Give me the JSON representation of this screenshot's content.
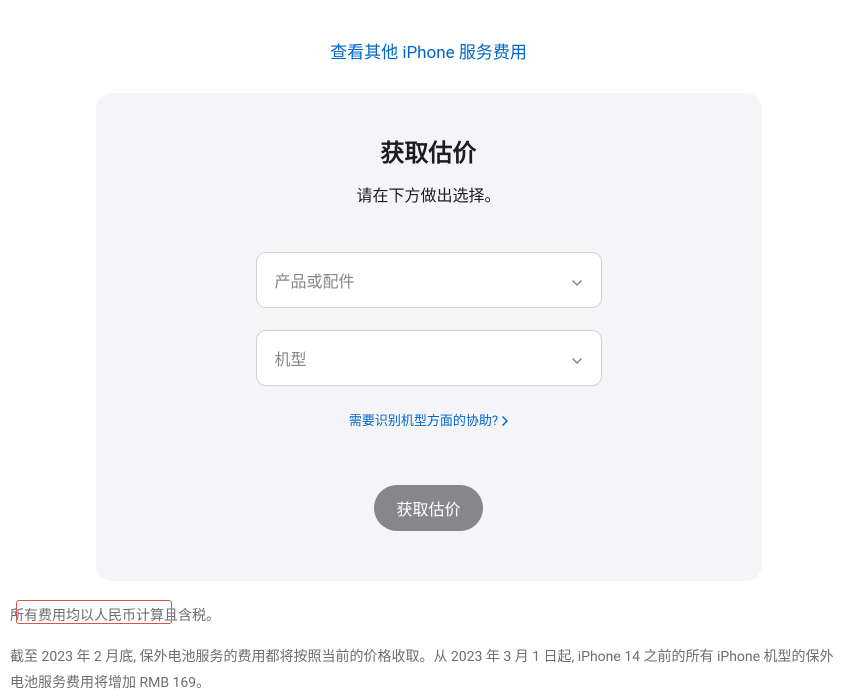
{
  "top_link": "查看其他 iPhone 服务费用",
  "card": {
    "title": "获取估价",
    "subtitle": "请在下方做出选择。",
    "select1_placeholder": "产品或配件",
    "select2_placeholder": "机型",
    "help_link": "需要识别机型方面的协助?",
    "submit_label": "获取估价"
  },
  "footer": {
    "line1": "所有费用均以人民币计算且含税。",
    "line2": "截至 2023 年 2 月底, 保外电池服务的费用都将按照当前的价格收取。从 2023 年 3 月 1 日起, iPhone 14 之前的所有 iPhone 机型的保外电池服务费用将增加 RMB 169。"
  }
}
